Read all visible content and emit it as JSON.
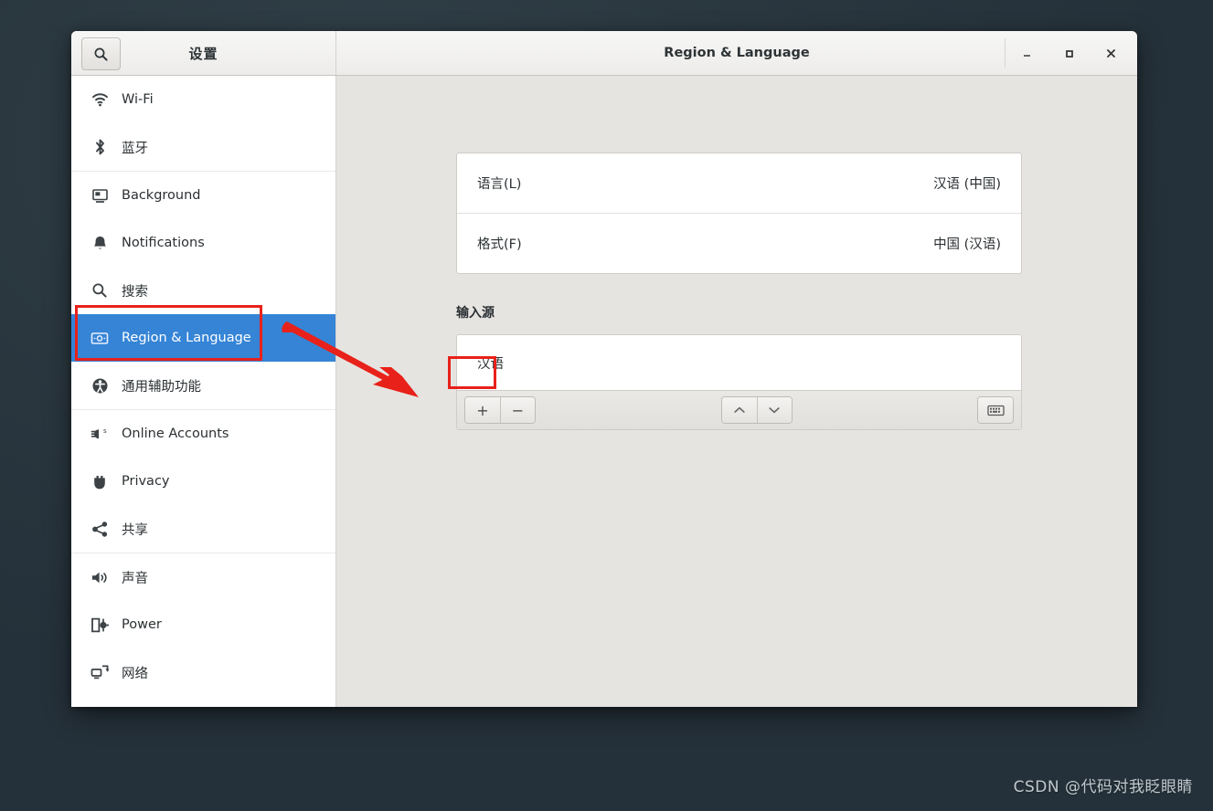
{
  "desktop": {
    "background_color": "#2b3840",
    "watermark": "CSDN @代码对我眨眼睛"
  },
  "window": {
    "title": "Region & Language",
    "sidebar_title": "设置",
    "controls": {
      "minimize": "–",
      "maximize": "□",
      "close": "✕"
    },
    "search_icon": "search-icon"
  },
  "sidebar": {
    "items": [
      {
        "label": "Wi-Fi",
        "icon": "wifi-icon",
        "selected": false,
        "divider_after": false
      },
      {
        "label": "蓝牙",
        "icon": "bluetooth-icon",
        "selected": false,
        "divider_after": true
      },
      {
        "label": "Background",
        "icon": "background-icon",
        "selected": false,
        "divider_after": false
      },
      {
        "label": "Notifications",
        "icon": "bell-icon",
        "selected": false,
        "divider_after": false
      },
      {
        "label": "搜索",
        "icon": "search-icon",
        "selected": false,
        "divider_after": false
      },
      {
        "label": "Region & Language",
        "icon": "region-language-icon",
        "selected": true,
        "divider_after": false
      },
      {
        "label": "通用辅助功能",
        "icon": "accessibility-icon",
        "selected": false,
        "divider_after": true
      },
      {
        "label": "Online Accounts",
        "icon": "online-accounts-icon",
        "selected": false,
        "divider_after": false
      },
      {
        "label": "Privacy",
        "icon": "privacy-hand-icon",
        "selected": false,
        "divider_after": false
      },
      {
        "label": "共享",
        "icon": "sharing-icon",
        "selected": false,
        "divider_after": true
      },
      {
        "label": "声音",
        "icon": "sound-icon",
        "selected": false,
        "divider_after": false
      },
      {
        "label": "Power",
        "icon": "power-icon",
        "selected": false,
        "divider_after": false
      },
      {
        "label": "网络",
        "icon": "network-icon",
        "selected": false,
        "divider_after": false
      }
    ]
  },
  "content": {
    "preferences": [
      {
        "label": "语言(L)",
        "value": "汉语 (中国)"
      },
      {
        "label": "格式(F)",
        "value": "中国 (汉语)"
      }
    ],
    "input_sources": {
      "heading": "输入源",
      "items": [
        "汉语"
      ],
      "toolbar": {
        "add": "+",
        "remove": "−",
        "move_up": "∧",
        "move_down": "∨",
        "keyboard": "keyboard-icon"
      }
    }
  },
  "annotations": {
    "highlight_color": "#e8211a",
    "boxes": [
      "region-language-sidebar-item",
      "add-input-source-button"
    ],
    "arrow": "points from Region & Language sidebar item to the add input source button"
  }
}
